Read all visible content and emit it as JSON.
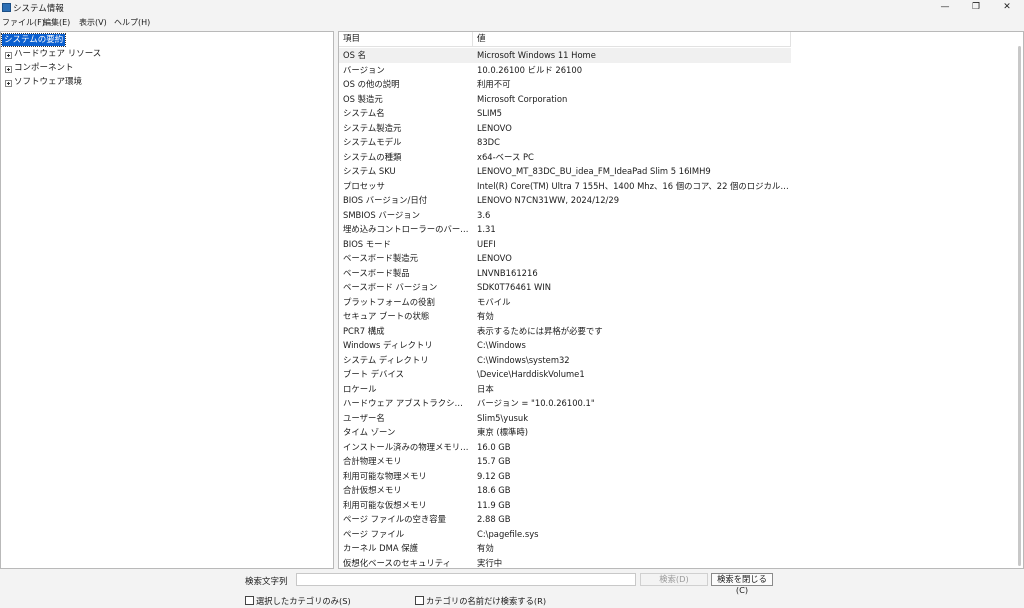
{
  "window": {
    "title": "システム情報"
  },
  "window_controls": {
    "minimize": "—",
    "maximize": "❐",
    "close": "✕"
  },
  "menu": [
    "ファイル(F)",
    "編集(E)",
    "表示(V)",
    "ヘルプ(H)"
  ],
  "tree": [
    {
      "label": "システムの要約",
      "selected": true,
      "expandable": false
    },
    {
      "label": "ハードウェア リソース",
      "selected": false,
      "expandable": true
    },
    {
      "label": "コンポーネント",
      "selected": false,
      "expandable": true
    },
    {
      "label": "ソフトウェア環境",
      "selected": false,
      "expandable": true
    }
  ],
  "table": {
    "headers": [
      "項目",
      "値"
    ],
    "rows": [
      [
        "OS 名",
        "Microsoft Windows 11 Home"
      ],
      [
        "バージョン",
        "10.0.26100 ビルド 26100"
      ],
      [
        "OS の他の説明",
        "利用不可"
      ],
      [
        "OS 製造元",
        "Microsoft Corporation"
      ],
      [
        "システム名",
        "SLIM5"
      ],
      [
        "システム製造元",
        "LENOVO"
      ],
      [
        "システムモデル",
        "83DC"
      ],
      [
        "システムの種類",
        "x64-ベース PC"
      ],
      [
        "システム SKU",
        "LENOVO_MT_83DC_BU_idea_FM_IdeaPad Slim 5 16IMH9"
      ],
      [
        "プロセッサ",
        "Intel(R) Core(TM) Ultra 7 155H、1400 Mhz、16 個のコア、22 個のロジカル プロセ..."
      ],
      [
        "BIOS バージョン/日付",
        "LENOVO N7CN31WW, 2024/12/29"
      ],
      [
        "SMBIOS バージョン",
        "3.6"
      ],
      [
        "埋め込みコントローラーのバージョン",
        "1.31"
      ],
      [
        "BIOS モード",
        "UEFI"
      ],
      [
        "ベースボード製造元",
        "LENOVO"
      ],
      [
        "ベースボード製品",
        "LNVNB161216"
      ],
      [
        "ベースボード バージョン",
        "SDK0T76461 WIN"
      ],
      [
        "プラットフォームの役割",
        "モバイル"
      ],
      [
        "セキュア ブートの状態",
        "有効"
      ],
      [
        "PCR7 構成",
        "表示するためには昇格が必要です"
      ],
      [
        "Windows ディレクトリ",
        "C:\\Windows"
      ],
      [
        "システム ディレクトリ",
        "C:\\Windows\\system32"
      ],
      [
        "ブート デバイス",
        "\\Device\\HarddiskVolume1"
      ],
      [
        "ロケール",
        "日本"
      ],
      [
        "ハードウェア アブストラクション レイ...",
        "バージョン = \"10.0.26100.1\""
      ],
      [
        "ユーザー名",
        "Slim5\\yusuk"
      ],
      [
        "タイム ゾーン",
        "東京 (標準時)"
      ],
      [
        "インストール済みの物理メモリ (RA...",
        "16.0 GB"
      ],
      [
        "合計物理メモリ",
        "15.7 GB"
      ],
      [
        "利用可能な物理メモリ",
        "9.12 GB"
      ],
      [
        "合計仮想メモリ",
        "18.6 GB"
      ],
      [
        "利用可能な仮想メモリ",
        "11.9 GB"
      ],
      [
        "ページ ファイルの空き容量",
        "2.88 GB"
      ],
      [
        "ページ ファイル",
        "C:\\pagefile.sys"
      ],
      [
        "カーネル DMA 保護",
        "有効"
      ],
      [
        "仮想化ベースのセキュリティ",
        "実行中"
      ]
    ]
  },
  "search": {
    "label": "検索文字列",
    "value": "",
    "search_button": "検索(D)",
    "close_button": "検索を閉じる(C)",
    "checkbox_selected_only": "選択したカテゴリのみ(S)",
    "checkbox_names_only": "カテゴリの名前だけ検索する(R)"
  },
  "colors": {
    "selection": "#0a5fd0",
    "window_bg": "#f3f3f3"
  }
}
